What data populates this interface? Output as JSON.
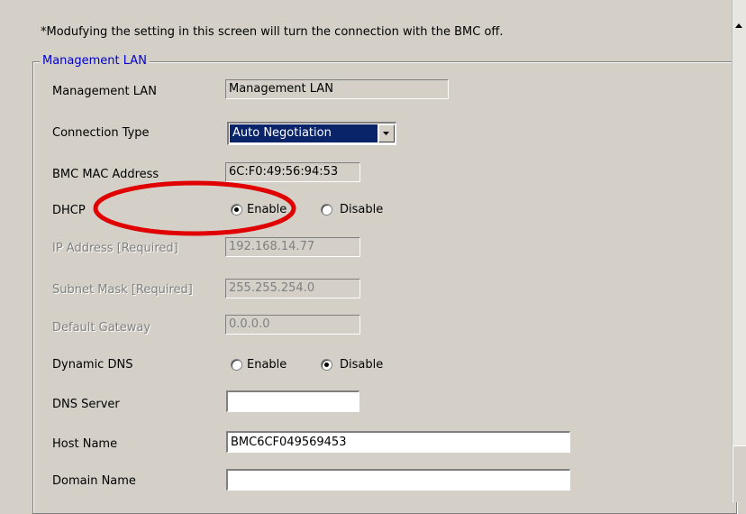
{
  "notice": "*Modufying the setting in this screen will turn the connection with the BMC off.",
  "group": {
    "title": "Management LAN"
  },
  "fields": {
    "management_lan": {
      "label": "Management LAN",
      "value": "Management LAN"
    },
    "connection_type": {
      "label": "Connection Type",
      "value": "Auto Negotiation"
    },
    "bmc_mac": {
      "label": "BMC MAC Address",
      "value": "6C:F0:49:56:94:53"
    },
    "dhcp": {
      "label": "DHCP",
      "option_enable": "Enable",
      "option_disable": "Disable",
      "selected": "Enable"
    },
    "ip_address": {
      "label": "IP Address  [Required]",
      "value": "192.168.14.77"
    },
    "subnet_mask": {
      "label": "Subnet Mask  [Required]",
      "value": "255.255.254.0"
    },
    "default_gateway": {
      "label": "Default Gateway",
      "value": "0.0.0.0"
    },
    "dynamic_dns": {
      "label": "Dynamic DNS",
      "option_enable": "Enable",
      "option_disable": "Disable",
      "selected": "Disable"
    },
    "dns_server": {
      "label": "DNS Server",
      "value": ""
    },
    "host_name": {
      "label": "Host Name",
      "value": "BMC6CF049569453"
    },
    "domain_name": {
      "label": "Domain Name",
      "value": ""
    }
  },
  "colors": {
    "background": "#d4d0c8",
    "group_title": "#0000c8",
    "selection": "#0a246a",
    "highlight_ellipse": "#e00000"
  },
  "icons": {
    "dropdown": "chevron-down-icon",
    "scroll_up": "scroll-up-arrow-icon"
  }
}
